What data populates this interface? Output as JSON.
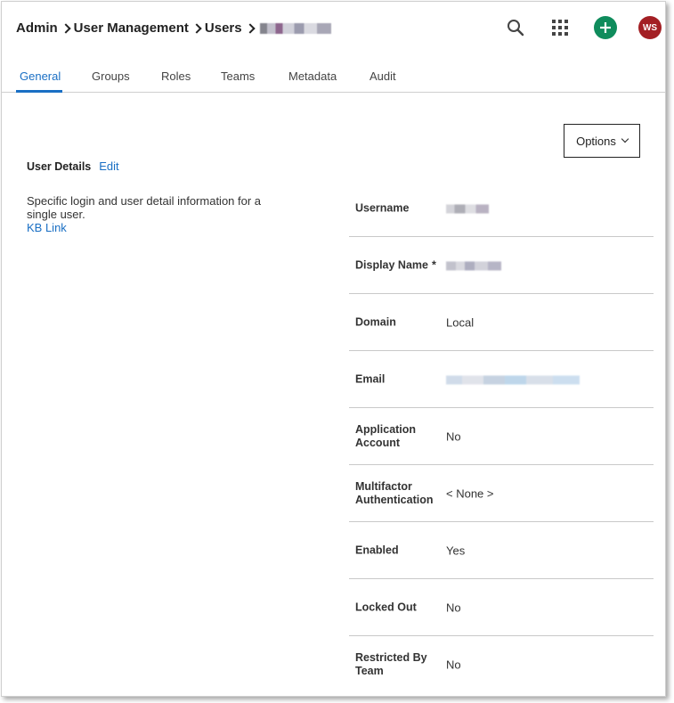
{
  "breadcrumb": {
    "items": [
      "Admin",
      "User Management",
      "Users"
    ],
    "current_redacted": true
  },
  "header": {
    "icons": {
      "search": "search-icon",
      "apps": "apps-grid-icon",
      "add": "plus-icon"
    },
    "avatar_initials": "WS",
    "colors": {
      "add_button": "#0f8c5c",
      "avatar": "#a31f24",
      "accent": "#1a6fc4"
    }
  },
  "tabs": [
    {
      "label": "General",
      "active": true
    },
    {
      "label": "Groups",
      "active": false
    },
    {
      "label": "Roles",
      "active": false
    },
    {
      "label": "Teams",
      "active": false
    },
    {
      "label": "Metadata",
      "active": false
    },
    {
      "label": "Audit",
      "active": false
    }
  ],
  "options_button": {
    "label": "Options"
  },
  "section": {
    "title": "User Details",
    "edit_label": "Edit",
    "description": "Specific login and user detail information for a single user.",
    "kb_link": "KB Link"
  },
  "details": [
    {
      "label": "Username",
      "value": "",
      "redacted": true
    },
    {
      "label": "Display Name",
      "required_mark": "*",
      "value": "",
      "redacted": true
    },
    {
      "label": "Domain",
      "value": "Local"
    },
    {
      "label": "Email",
      "value": "",
      "redacted": true
    },
    {
      "label": "Application Account",
      "value": "No"
    },
    {
      "label": "Multifactor Authentication",
      "value": "< None >"
    },
    {
      "label": "Enabled",
      "value": "Yes"
    },
    {
      "label": "Locked Out",
      "value": "No"
    },
    {
      "label": "Restricted By Team",
      "value": "No"
    }
  ]
}
